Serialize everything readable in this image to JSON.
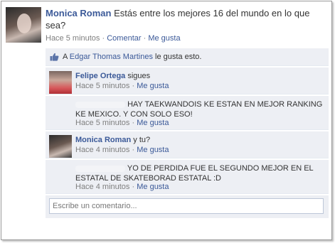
{
  "post": {
    "author": "Monica Roman",
    "text": "Estás entre los mejores 16 del mundo en lo que sea?",
    "time": "Hace 5 minutos",
    "comment_link": "Comentar",
    "like_link": "Me gusta",
    "separator": "·"
  },
  "likes": {
    "prefix": "A",
    "liker": "Edgar Thomas Martines",
    "suffix": "le gusta esto."
  },
  "comments": [
    {
      "author": "Felipe Ortega",
      "text": "sigues",
      "time": "Hace 5 minutos",
      "like_link": "Me gusta"
    },
    {
      "author": "",
      "text": "HAY TAEKWANDOIS KE ESTAN EN MEJOR RANKING KE MEXICO. Y CON SOLO ESO!",
      "time": "Hace 5 minutos",
      "like_link": "Me gusta"
    },
    {
      "author": "Monica Roman",
      "text": "y tu?",
      "time": "Hace 4 minutos",
      "like_link": "Me gusta"
    },
    {
      "author": "",
      "text": "YO DE PERDIDA FUE EL SEGUNDO MEJOR EN EL ESTATAL DE SKATEBORAD ESTATAL :D",
      "time": "Hace 4 minutos",
      "like_link": "Me gusta"
    }
  ],
  "composer": {
    "placeholder": "Escribe un comentario..."
  },
  "colors": {
    "link": "#3b5998",
    "comment_bg": "#edeff4",
    "meta_text": "#7f7f7f"
  }
}
